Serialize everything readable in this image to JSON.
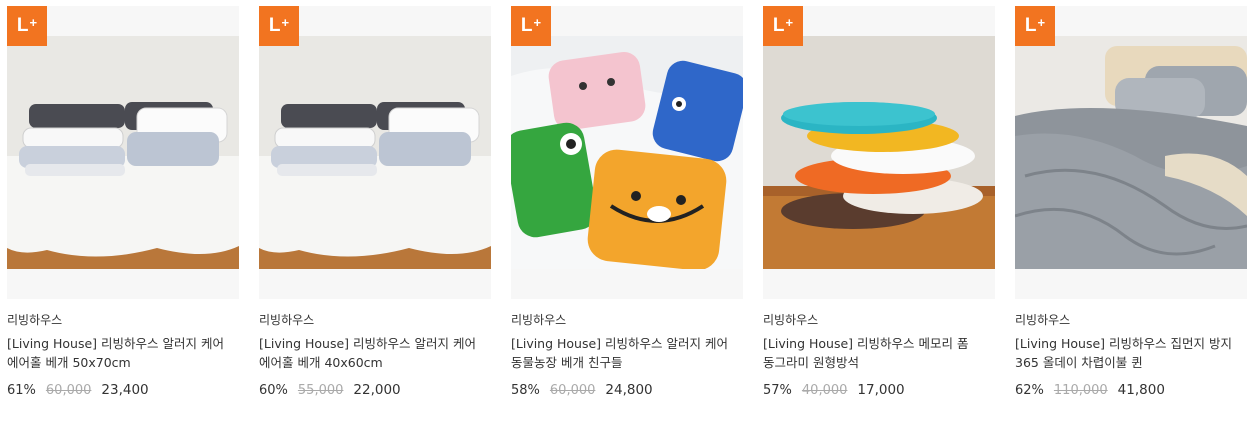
{
  "badge": {
    "label": "L",
    "plus": "+",
    "color": "#f27420"
  },
  "products": [
    {
      "brand": "리빙하우스",
      "title": "[Living House] 리빙하우스 알러지 케어 에어홀 베개 50x70cm",
      "discount": "61%",
      "original_price": "60,000",
      "price": "23,400",
      "image": "bed-pillows-photo"
    },
    {
      "brand": "리빙하우스",
      "title": "[Living House] 리빙하우스 알러지 케어 에어홀 베개 40x60cm",
      "discount": "60%",
      "original_price": "55,000",
      "price": "22,000",
      "image": "bed-pillows-photo"
    },
    {
      "brand": "리빙하우스",
      "title": "[Living House] 리빙하우스 알러지 케어 동물농장 베개 친구들",
      "discount": "58%",
      "original_price": "60,000",
      "price": "24,800",
      "image": "animal-pillows-photo"
    },
    {
      "brand": "리빙하우스",
      "title": "[Living House] 리빙하우스 메모리 폼 동그라미 원형방석",
      "discount": "57%",
      "original_price": "40,000",
      "price": "17,000",
      "image": "round-cushions-photo"
    },
    {
      "brand": "리빙하우스",
      "title": "[Living House] 리빙하우스 집먼지 방지 365 올데이 차렵이불 퀸",
      "discount": "62%",
      "original_price": "110,000",
      "price": "41,800",
      "image": "comforter-photo"
    }
  ]
}
